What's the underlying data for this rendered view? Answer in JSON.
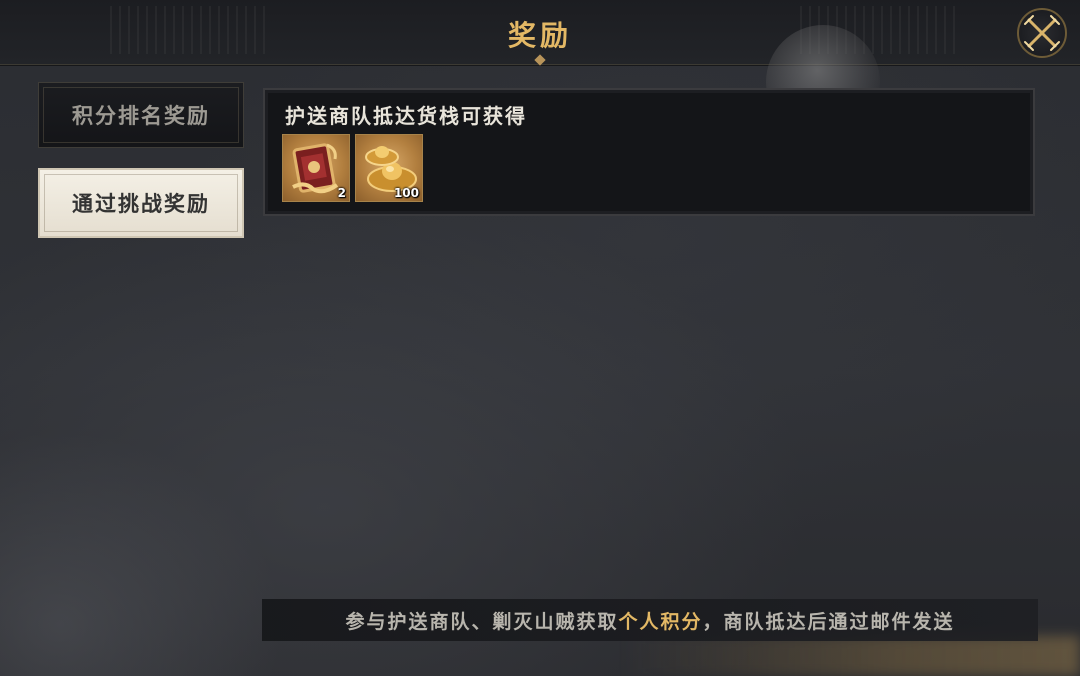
{
  "header": {
    "title": "奖励",
    "close_icon": "crossed-swords-close-icon"
  },
  "tabs": [
    {
      "label": "积分排名奖励",
      "selected": false
    },
    {
      "label": "通过挑战奖励",
      "selected": true
    }
  ],
  "reward_panel": {
    "title": "护送商队抵达货栈可获得",
    "items": [
      {
        "icon": "red-scroll-token-icon",
        "count": "2"
      },
      {
        "icon": "gold-ingot-icon",
        "count": "100"
      }
    ]
  },
  "notice": {
    "text_before": "参与护送商队、剿灭山贼获取",
    "highlight": "个人积分",
    "text_after": "，商队抵达后通过邮件发送"
  },
  "colors": {
    "accent_gold": "#e3b865",
    "panel_bg": "#141518",
    "selected_tab_bg": "#f4f0e6"
  }
}
